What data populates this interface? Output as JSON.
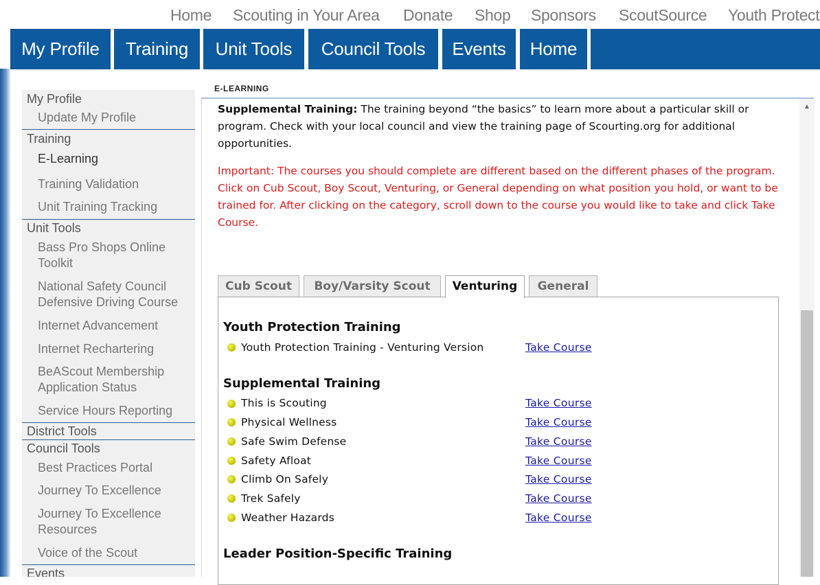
{
  "top_links": [
    "Home",
    "Scouting in Your Area",
    "Donate",
    "Shop",
    "Sponsors",
    "ScoutSource",
    "Youth Protect"
  ],
  "main_nav": [
    "My Profile",
    "Training",
    "Unit Tools",
    "Council Tools",
    "Events",
    "Home"
  ],
  "sidebar": {
    "my_profile": "My Profile",
    "update_profile": "Update My Profile",
    "training": "Training",
    "e_learning": "E-Learning",
    "training_validation": "Training Validation",
    "unit_training_tracking": "Unit Training Tracking",
    "unit_tools": "Unit Tools",
    "bass_pro_1": "Bass Pro Shops Online",
    "bass_pro_2": "Toolkit",
    "nsc_1": "National Safety Council",
    "nsc_2": "Defensive Driving Course",
    "internet_advancement": "Internet Advancement",
    "internet_rechartering": "Internet Rechartering",
    "beascout_1": "BeAScout Membership",
    "beascout_2": "Application Status",
    "service_hours": "Service Hours Reporting",
    "district_tools": "District Tools",
    "council_tools": "Council Tools",
    "best_practices": "Best Practices Portal",
    "jte": "Journey To Excellence",
    "jte_res_1": "Journey To Excellence",
    "jte_res_2": "Resources",
    "voice": "Voice of the Scout",
    "events": "Events"
  },
  "content": {
    "section_label": "E-LEARNING",
    "intro_bold": "Supplemental Training:",
    "intro_text": " The training beyond “the basics” to learn more about a particular skill or program. Check with your local council and view the training page of Scourting.org for additional opportunities.",
    "important": "Important: The courses you should complete are different based on the different phases of the program. Click on Cub Scout, Boy Scout, Venturing, or General depending on what position you hold, or want to be trained for. After clicking on the category, scroll down to the course you would like to take and click Take Course."
  },
  "tabs": [
    "Cub Scout",
    "Boy/Varsity Scout",
    "Venturing",
    "General"
  ],
  "active_tab": "Venturing",
  "groups": {
    "youth_protection": "Youth Protection Training",
    "supplemental": "Supplemental Training",
    "leader": "Leader Position-Specific Training"
  },
  "courses": {
    "ypt": "Youth Protection Training - Venturing Version",
    "c1": "This is Scouting",
    "c2": "Physical Wellness",
    "c3": "Safe Swim Defense",
    "c4": "Safety Afloat",
    "c5": "Climb On Safely",
    "c6": "Trek Safely",
    "c7": "Weather Hazards"
  },
  "take_course_label": "Take Course",
  "colors": {
    "nav_blue": "#0e5a9e",
    "important_red": "#e21b1b",
    "link_blue": "#1a1aa6"
  }
}
